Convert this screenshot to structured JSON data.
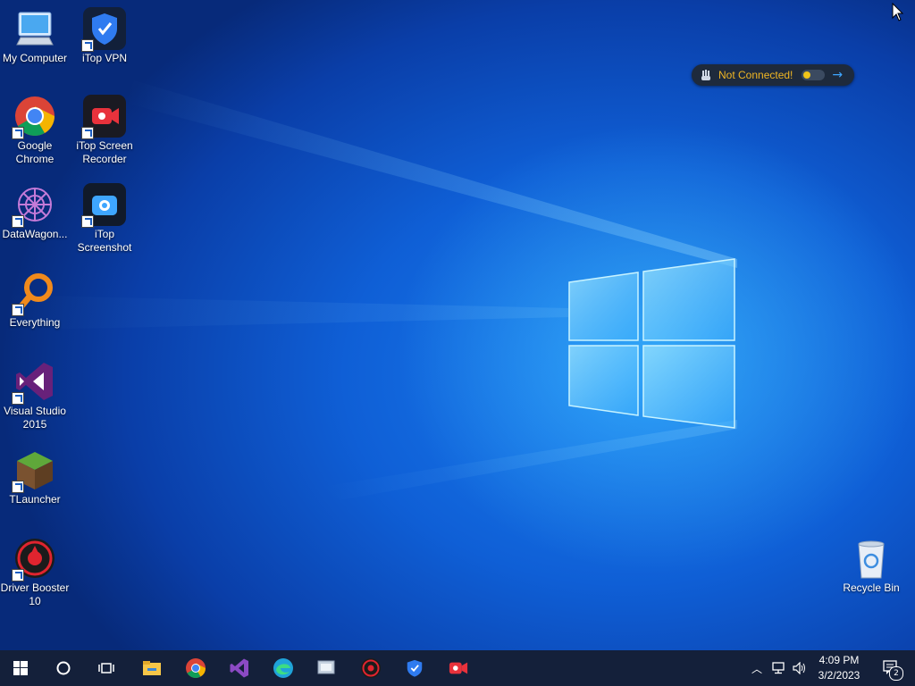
{
  "desktop": {
    "icons": [
      {
        "label": "My Computer",
        "icon": "computer-icon"
      },
      {
        "label": "iTop VPN",
        "icon": "itop-vpn-icon"
      },
      {
        "label": "Google Chrome",
        "icon": "chrome-icon"
      },
      {
        "label": "iTop Screen Recorder",
        "icon": "itop-screen-recorder-icon"
      },
      {
        "label": "DataWagon...",
        "icon": "datawagon-icon"
      },
      {
        "label": "iTop Screenshot",
        "icon": "itop-screenshot-icon"
      },
      {
        "label": "Everything",
        "icon": "everything-icon"
      },
      {
        "label": "Visual Studio 2015",
        "icon": "visual-studio-icon"
      },
      {
        "label": "TLauncher",
        "icon": "tlauncher-icon"
      },
      {
        "label": "Driver Booster 10",
        "icon": "driver-booster-icon"
      },
      {
        "label": "Recycle Bin",
        "icon": "recycle-bin-icon"
      }
    ]
  },
  "vpn_widget": {
    "status": "Not Connected!",
    "status_color": "#f0b623"
  },
  "taskbar": {
    "pinned": [
      "start-icon",
      "search-icon",
      "task-view-icon",
      "file-explorer-icon",
      "chrome-icon",
      "visual-studio-icon",
      "edge-icon",
      "datawagon-icon",
      "driver-booster-icon",
      "itop-vpn-icon",
      "itop-screen-recorder-icon"
    ],
    "clock": {
      "time": "4:09 PM",
      "date": "3/2/2023"
    },
    "notifications_count": "2"
  }
}
